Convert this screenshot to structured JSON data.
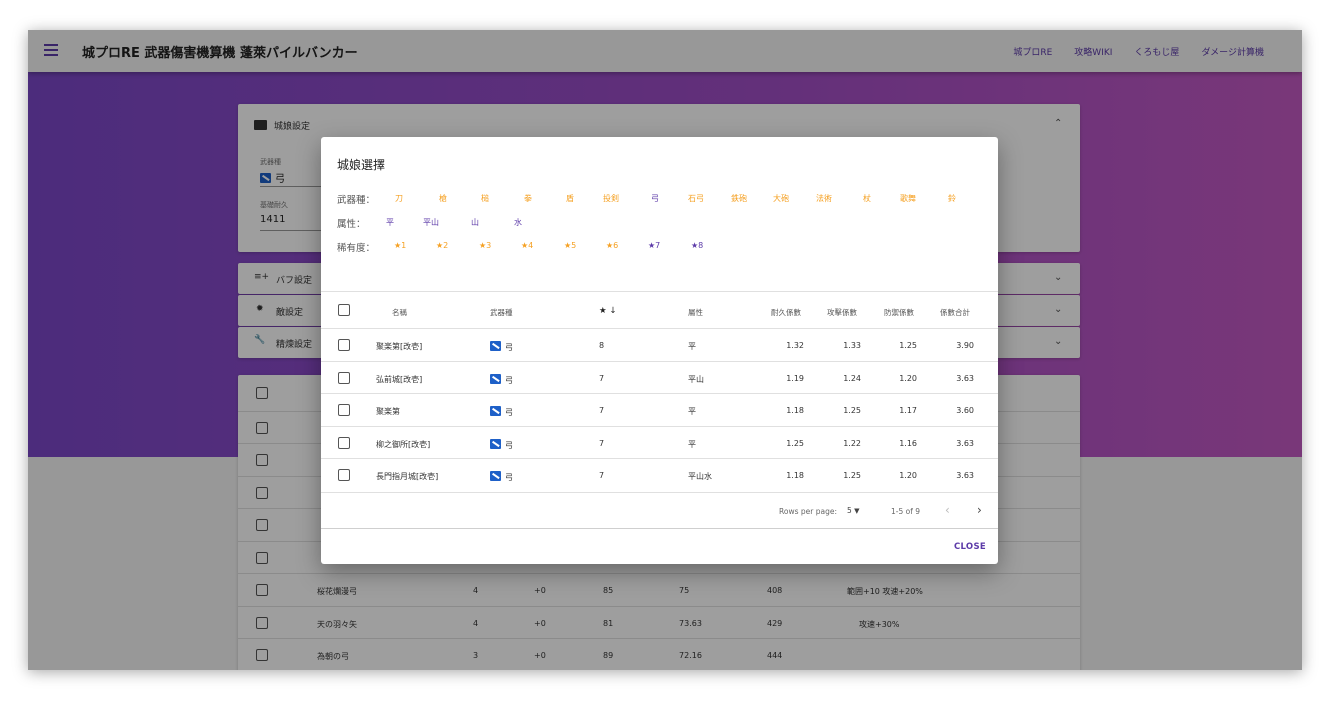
{
  "app": {
    "title": "城プロRE 武器傷害機算機 蓬萊パイルバンカー",
    "nav": [
      "城プロRE",
      "攻略WIKI",
      "くろもじ屋",
      "ダメージ計算機"
    ]
  },
  "page": {
    "settings_panel": {
      "title": "城娘設定",
      "weapon_label": "武器種",
      "weapon_value": "弓",
      "durability_label": "基礎耐久",
      "durability_value": "1411"
    },
    "panels": [
      {
        "icon": "buff-icon",
        "label": "バフ設定"
      },
      {
        "icon": "enemy-icon",
        "label": "敵設定"
      },
      {
        "icon": "wrench-icon",
        "label": "精煉設定"
      }
    ],
    "table_rows": [
      {
        "name": "桜花爛漫弓",
        "a": "4",
        "b": "+0",
        "c": "85",
        "d": "75",
        "e": "408",
        "effect": "範囲+10 攻速+20%"
      },
      {
        "name": "天の羽々矢",
        "a": "4",
        "b": "+0",
        "c": "81",
        "d": "73.63",
        "e": "429",
        "effect": "攻速+30%"
      },
      {
        "name": "為朝の弓",
        "a": "3",
        "b": "+0",
        "c": "89",
        "d": "72.16",
        "e": "444",
        "effect": ""
      }
    ]
  },
  "dialog": {
    "title": "城娘選擇",
    "weapon_filter_label": "武器種：",
    "weapon_types": [
      "刀",
      "槍",
      "槌",
      "拳",
      "盾",
      "投剣",
      "弓",
      "石弓",
      "鉄砲",
      "大砲",
      "法術",
      "杖",
      "歌舞",
      "鈴"
    ],
    "selected_weapon": "弓",
    "attribute_label": "属性：",
    "attributes": [
      "平",
      "平山",
      "山",
      "水"
    ],
    "rarity_label": "稀有度：",
    "rarities": [
      "★1",
      "★2",
      "★3",
      "★4",
      "★5",
      "★6",
      "★7",
      "★8"
    ],
    "selected_rarities": [
      "★7",
      "★8"
    ],
    "columns": {
      "name": "名稱",
      "weapon": "武器種",
      "rarity": "★",
      "sort_arrow": "↓",
      "attribute": "屬性",
      "hp_coef": "耐久係數",
      "atk_coef": "攻擊係數",
      "def_coef": "防禦係數",
      "total_coef": "係數合計"
    },
    "rows": [
      {
        "name": "聚楽第[改壱]",
        "weapon": "弓",
        "rarity": "8",
        "attribute": "平",
        "hp": "1.32",
        "atk": "1.33",
        "def": "1.25",
        "total": "3.90"
      },
      {
        "name": "弘前城[改壱]",
        "weapon": "弓",
        "rarity": "7",
        "attribute": "平山",
        "hp": "1.19",
        "atk": "1.24",
        "def": "1.20",
        "total": "3.63"
      },
      {
        "name": "聚楽第",
        "weapon": "弓",
        "rarity": "7",
        "attribute": "平",
        "hp": "1.18",
        "atk": "1.25",
        "def": "1.17",
        "total": "3.60"
      },
      {
        "name": "柳之御所[改壱]",
        "weapon": "弓",
        "rarity": "7",
        "attribute": "平",
        "hp": "1.25",
        "atk": "1.22",
        "def": "1.16",
        "total": "3.63"
      },
      {
        "name": "長門指月城[改壱]",
        "weapon": "弓",
        "rarity": "7",
        "attribute": "平山水",
        "hp": "1.18",
        "atk": "1.25",
        "def": "1.20",
        "total": "3.63"
      }
    ],
    "pagination": {
      "rows_per_page_label": "Rows per page:",
      "rows_per_page": "5",
      "range": "1-5 of 9"
    },
    "close_label": "CLOSE"
  },
  "colors": {
    "accent": "#5c3aa8",
    "chip_orange": "#f5a022",
    "hero_gradient_start": "#7b48c8",
    "hero_gradient_end": "#c45ac4"
  }
}
